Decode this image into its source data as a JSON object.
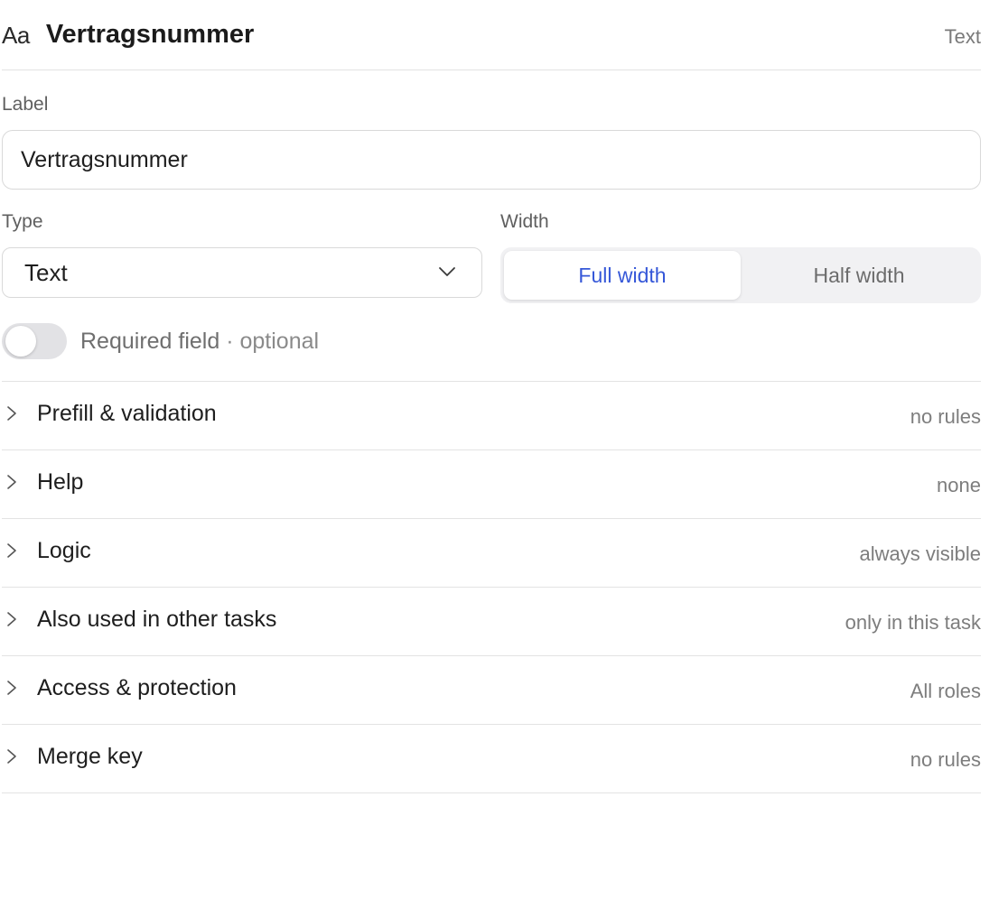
{
  "header": {
    "type_glyph": "Aa",
    "title": "Vertragsnummer",
    "type_badge": "Text"
  },
  "label_field": {
    "label": "Label",
    "value": "Vertragsnummer"
  },
  "type_field": {
    "label": "Type",
    "selected": "Text",
    "icon": "chevron-down-icon"
  },
  "width_field": {
    "label": "Width",
    "options": [
      "Full width",
      "Half width"
    ],
    "selected": "Full width",
    "accent": "#3557d8"
  },
  "required_toggle": {
    "label": "Required field",
    "suffix": " · optional",
    "on": false
  },
  "sections": [
    {
      "title": "Prefill & validation",
      "meta": "no rules"
    },
    {
      "title": "Help",
      "meta": "none"
    },
    {
      "title": "Logic",
      "meta": "always visible"
    },
    {
      "title": "Also used in other tasks",
      "meta": "only in this task"
    },
    {
      "title": "Access & protection",
      "meta": "All roles"
    },
    {
      "title": "Merge key",
      "meta": "no rules"
    }
  ]
}
